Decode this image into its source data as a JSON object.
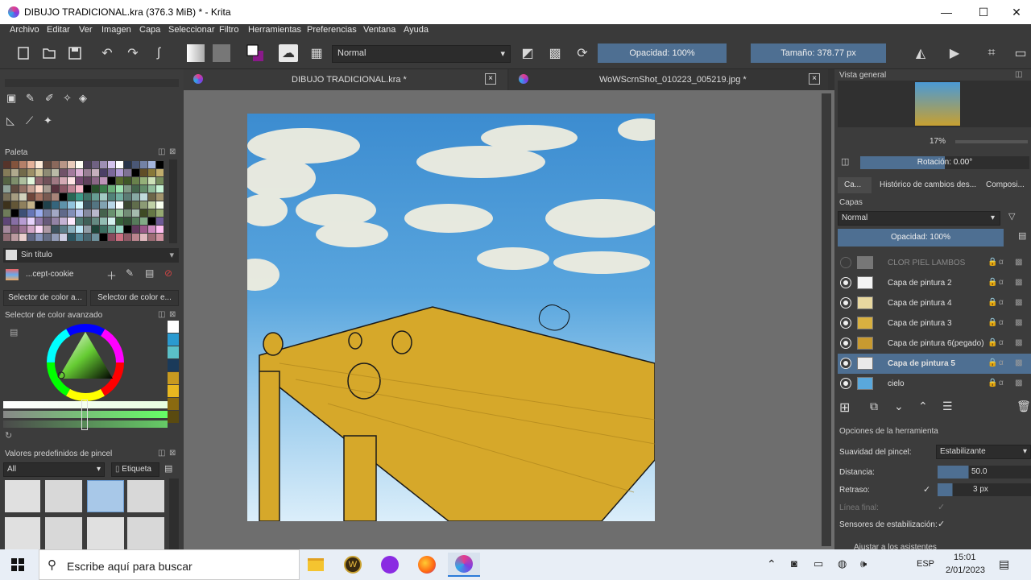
{
  "window": {
    "title": "DIBUJO TRADICIONAL.kra (376.3 MiB)  * - Krita"
  },
  "menu": [
    "Archivo",
    "Editar",
    "Ver",
    "Imagen",
    "Capa",
    "Seleccionar",
    "Filtro",
    "Herramientas",
    "Preferencias",
    "Ventana",
    "Ayuda"
  ],
  "toolbar": {
    "blend_mode": "Normal",
    "opacity": "Opacidad: 100%",
    "size": "Tamaño: 378.77 px"
  },
  "tabs": [
    {
      "label": "DIBUJO TRADICIONAL.kra *",
      "close": "×"
    },
    {
      "label": "WoWScrnShot_010223_005219.jpg *",
      "close": "×"
    }
  ],
  "left": {
    "palette_title": "Paleta",
    "palette_name": "Sin título",
    "palette_set": "...cept-cookie",
    "color_tab1": "Selector de color a...",
    "color_tab2": "Selector de color e...",
    "adv_selector_title": "Selector de color avanzado",
    "brush_presets_title": "Valores predefinidos de pincel",
    "brush_filter": "All",
    "brush_tag": "Etiqueta",
    "swatch_colors": [
      "#7b4a3c",
      "#a0664a",
      "#c08870",
      "#d8a890",
      "#e8c8b8",
      "#8c6a5a",
      "#a88070",
      "#c4a090",
      "#dcc0b0",
      "#f0e0d0",
      "#6a5a7a",
      "#8878a0",
      "#a898c0",
      "#c8b8e0",
      "#e8d8f0",
      "#3a4a6a",
      "#5a6a90",
      "#7a8ab0",
      "#9aaad0",
      "#000000"
    ],
    "stops": [
      "#ffffff",
      "#2a9ad0",
      "#5ac0c8",
      "#1a3a5a",
      "#c89a20",
      "#e8b820",
      "#8a6a10",
      "#5a4a10"
    ]
  },
  "right": {
    "overview_title": "Vista general",
    "zoom": "17%",
    "rotation": "Rotación: 0.00°",
    "tabs": [
      "Ca...",
      "Histórico de cambios des...",
      "Composi..."
    ],
    "layers_title": "Capas",
    "layer_blend": "Normal",
    "layer_opacity": "Opacidad:  100%",
    "layers": [
      {
        "name": "CLOR PIEL LAMBOS",
        "visible": false,
        "selected": false,
        "thumb": "#777"
      },
      {
        "name": "Capa de pintura 2",
        "visible": true,
        "selected": false,
        "thumb": "#f4f4f4"
      },
      {
        "name": "Capa de pintura 4",
        "visible": true,
        "selected": false,
        "thumb": "#e8d8a0"
      },
      {
        "name": "Capa de pintura 3",
        "visible": true,
        "selected": false,
        "thumb": "#d8b040"
      },
      {
        "name": "Capa de pintura 6(pegado)",
        "visible": true,
        "selected": false,
        "thumb": "#c89a30"
      },
      {
        "name": "Capa de pintura 5",
        "visible": true,
        "selected": true,
        "thumb": "#eaeaea"
      },
      {
        "name": "cielo",
        "visible": true,
        "selected": false,
        "thumb": "#5aa8dc"
      }
    ],
    "tool_options_title": "Opciones de la herramienta",
    "smoothing_label": "Suavidad del pincel:",
    "smoothing_value": "Estabilizante",
    "distance_label": "Distancia:",
    "distance_value": "50.0",
    "delay_label": "Retraso:",
    "delay_value": "3 px",
    "finish_label": "Línea final:",
    "sensors_label": "Sensores de estabilización:",
    "assist_label": "Ajustar a los asistentes"
  },
  "taskbar": {
    "search_placeholder": "Escribe aquí para buscar",
    "lang": "ESP",
    "time": "15:01",
    "date": "2/01/2023"
  }
}
